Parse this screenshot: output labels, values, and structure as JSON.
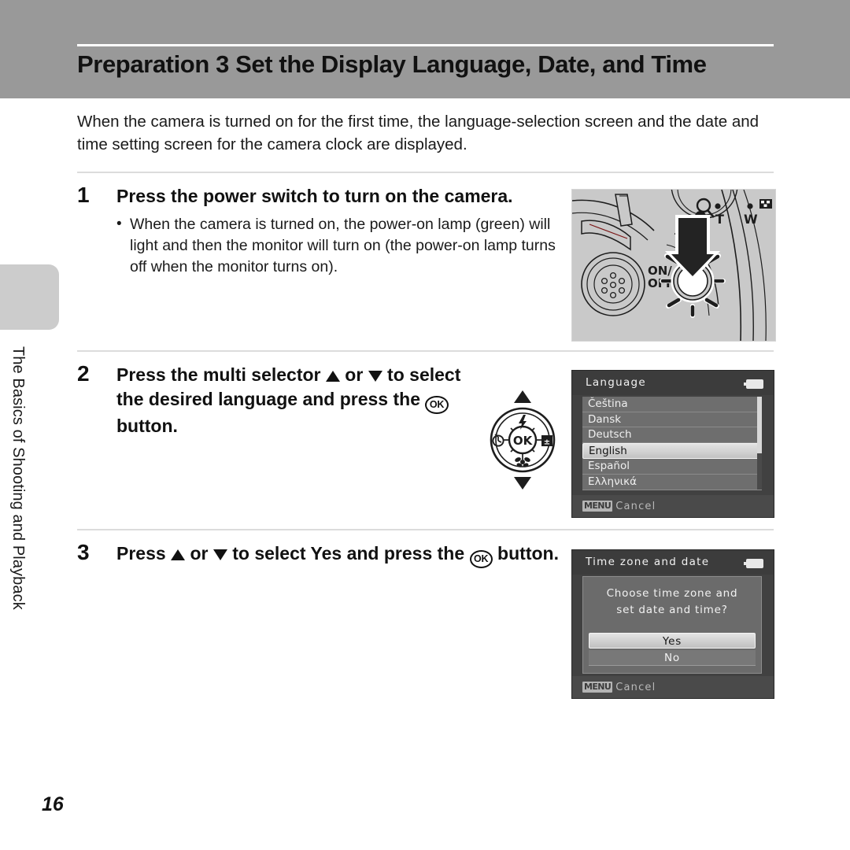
{
  "header": {
    "title": "Preparation 3 Set the Display Language, Date, and Time"
  },
  "sidebar": {
    "chapter_label": "The Basics of Shooting and Playback"
  },
  "intro": "When the camera is turned on for the first time, the language-selection screen and the date and time setting screen for the camera clock are displayed.",
  "steps": [
    {
      "number": "1",
      "heading": "Press the power switch to turn on the camera.",
      "bullet": "When the camera is turned on, the power-on lamp (green) will light and then the monitor will turn on (the power-on lamp turns off when the monitor turns on)."
    },
    {
      "number": "2",
      "heading_part1": "Press the multi selector ",
      "heading_part2": " or ",
      "heading_part3": " to select the desired language and press the ",
      "heading_part4": " button."
    },
    {
      "number": "3",
      "heading_part1": "Press ",
      "heading_part2": " or ",
      "heading_part3": " to select ",
      "heading_bold": "Yes",
      "heading_part4": " and press the ",
      "heading_part5": " button."
    }
  ],
  "camera_illustration": {
    "power_label_line1": "ON/",
    "power_label_line2": "OFF",
    "tele_label": "T",
    "wide_label": "W",
    "alt_text": "Camera top view with power switch and zoom control"
  },
  "multi_selector": {
    "ok_label": "OK",
    "alt_text": "Multi selector rotary dial with flash, self-timer, exposure compensation and macro icons"
  },
  "language_screen": {
    "title": "Language",
    "items": [
      {
        "label": "Čeština",
        "selected": false
      },
      {
        "label": "Dansk",
        "selected": false
      },
      {
        "label": "Deutsch",
        "selected": false
      },
      {
        "label": "English",
        "selected": true
      },
      {
        "label": "Español",
        "selected": false
      },
      {
        "label": "Ελληνικά",
        "selected": false
      }
    ],
    "footer_badge": "MENU",
    "footer_label": "Cancel"
  },
  "timezone_screen": {
    "title": "Time zone and date",
    "message_line1": "Choose time zone and",
    "message_line2": "set date and time?",
    "yes_label": "Yes",
    "no_label": "No",
    "footer_badge": "MENU",
    "footer_label": "Cancel"
  },
  "page_number": "16",
  "colors": {
    "header_band": "#999999",
    "side_tab": "#cccccc",
    "screen_bg": "#414141",
    "screen_title_bar": "#3c3c3c",
    "list_bg": "#6e6e6e",
    "highlight": "#d6d6d6"
  }
}
